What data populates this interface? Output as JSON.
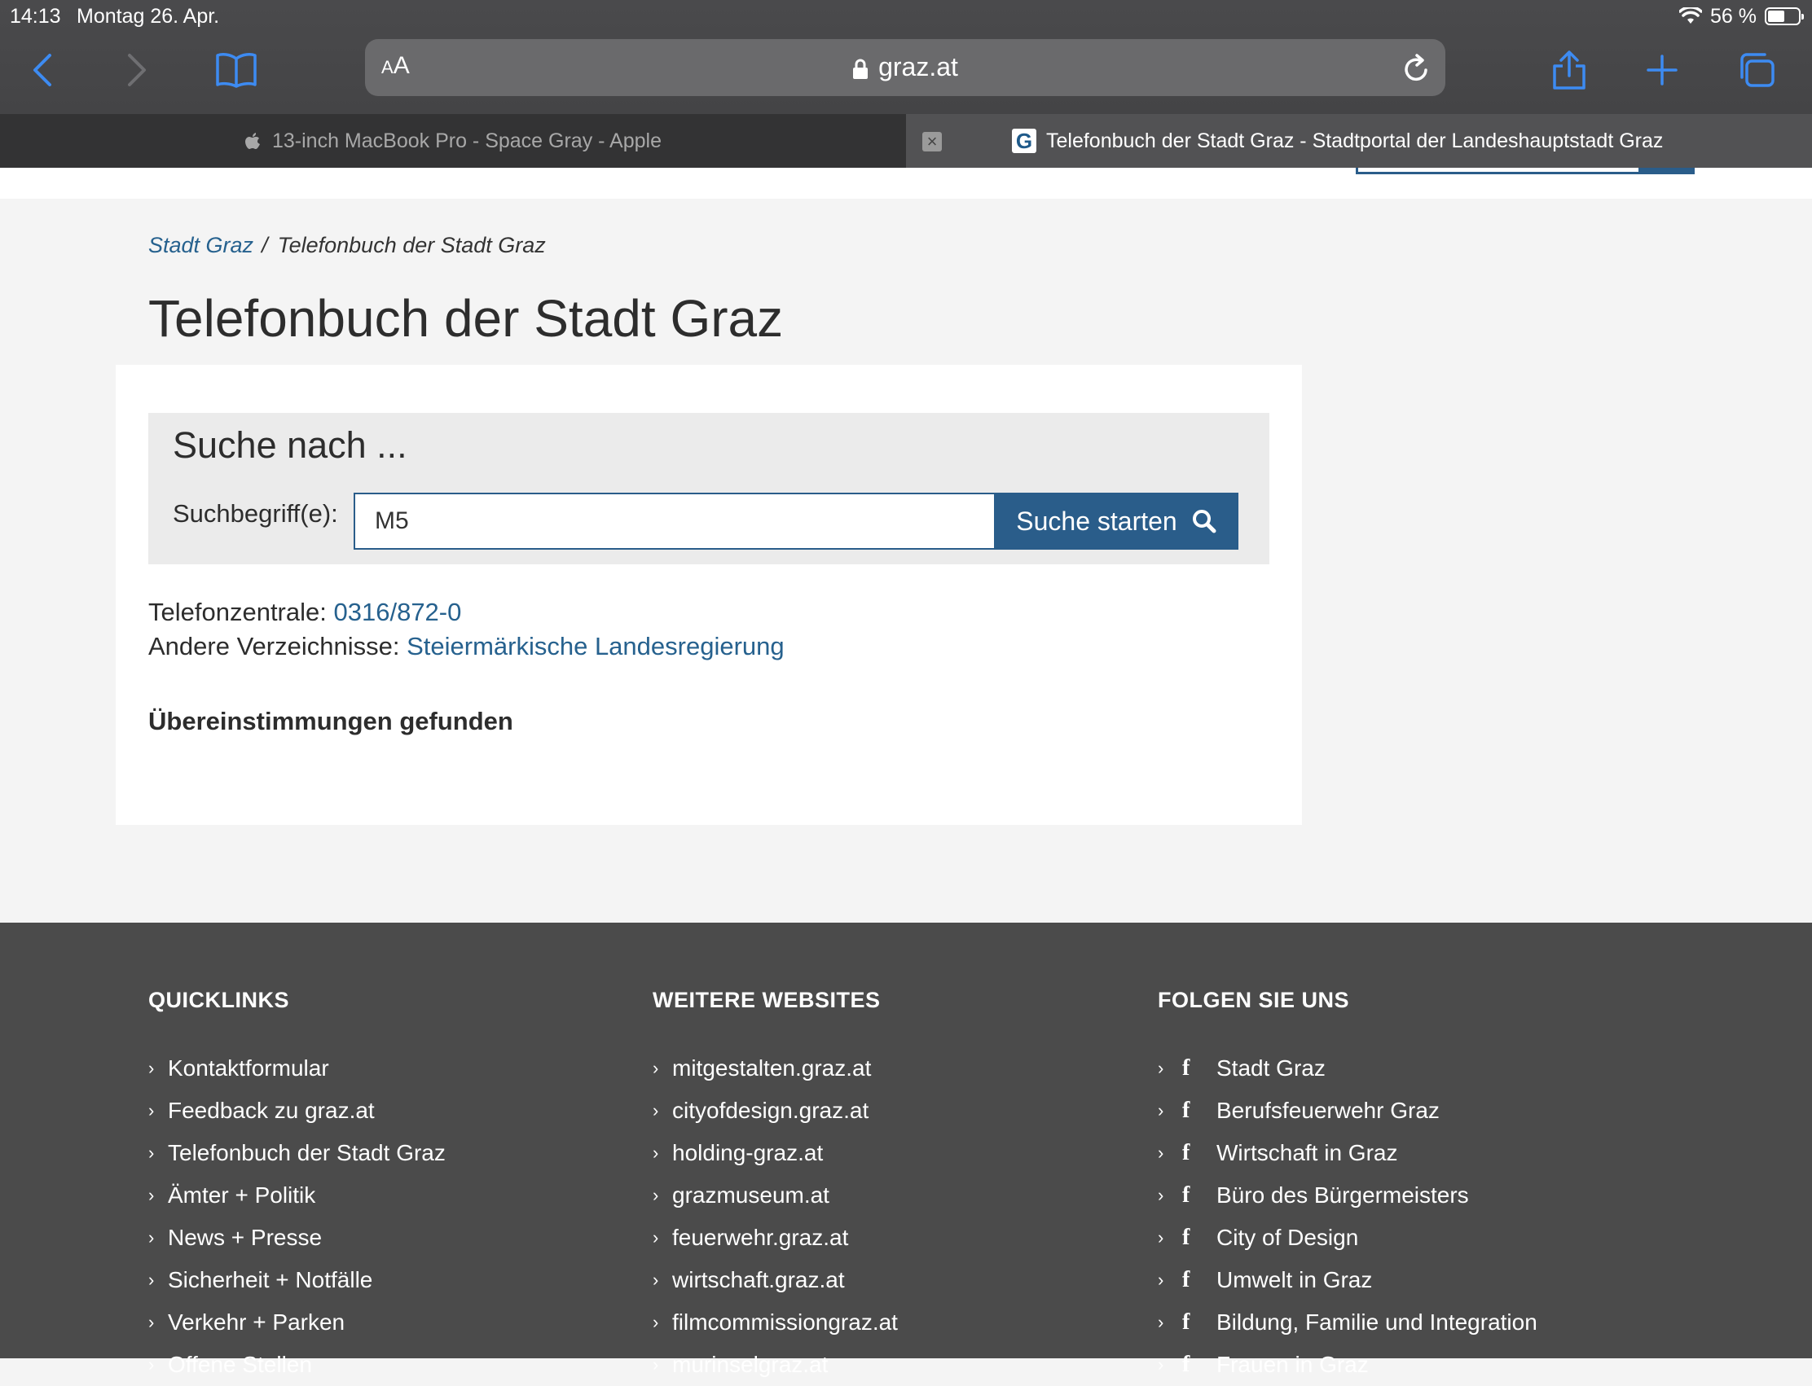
{
  "status_bar": {
    "time": "14:13",
    "date": "Montag 26. Apr.",
    "battery": "56 %"
  },
  "browser": {
    "aa_label": "AA",
    "url_domain": "graz.at",
    "tabs": [
      {
        "title": "13-inch MacBook Pro - Space Gray - Apple"
      },
      {
        "title": "Telefonbuch der Stadt Graz - Stadtportal der Landeshauptstadt Graz",
        "favicon": "G"
      }
    ],
    "tab_close_glyph": "×"
  },
  "breadcrumb": {
    "home": "Stadt Graz",
    "sep": "/",
    "current": "Telefonbuch der Stadt Graz"
  },
  "page_title": "Telefonbuch der Stadt Graz",
  "search": {
    "heading": "Suche nach ...",
    "label": "Suchbegriff(e):",
    "value": "M5",
    "button_label": "Suche starten"
  },
  "info": {
    "zentrale_label": "Telefonzentrale:",
    "zentrale_number": "0316/872-0",
    "andere_label": "Andere Verzeichnisse:",
    "andere_link": "Steiermärkische Landesregierung"
  },
  "matches_text": "Übereinstimmungen gefunden",
  "footer": {
    "quicklinks": {
      "title": "QUICKLINKS",
      "items": [
        "Kontaktformular",
        "Feedback zu graz.at",
        "Telefonbuch der Stadt Graz",
        "Ämter + Politik",
        "News + Presse",
        "Sicherheit + Notfälle",
        "Verkehr + Parken",
        "Offene Stellen"
      ]
    },
    "websites": {
      "title": "WEITERE WEBSITES",
      "items": [
        "mitgestalten.graz.at",
        "cityofdesign.graz.at",
        "holding-graz.at",
        "grazmuseum.at",
        "feuerwehr.graz.at",
        "wirtschaft.graz.at",
        "filmcommissiongraz.at",
        "murinselgraz.at"
      ]
    },
    "social": {
      "title": "FOLGEN SIE UNS",
      "items": [
        "Stadt Graz",
        "Berufsfeuerwehr Graz",
        "Wirtschaft in Graz",
        "Büro des Bürgermeisters",
        "City of Design",
        "Umwelt in Graz",
        "Bildung, Familie und Integration",
        "Frauen in Graz"
      ]
    }
  },
  "colors": {
    "accent": "#2a5d8a",
    "link": "#26618e",
    "footer_bg": "#4b4b4b",
    "chrome_bg": "#444446",
    "ios_blue": "#3d8bf2"
  }
}
